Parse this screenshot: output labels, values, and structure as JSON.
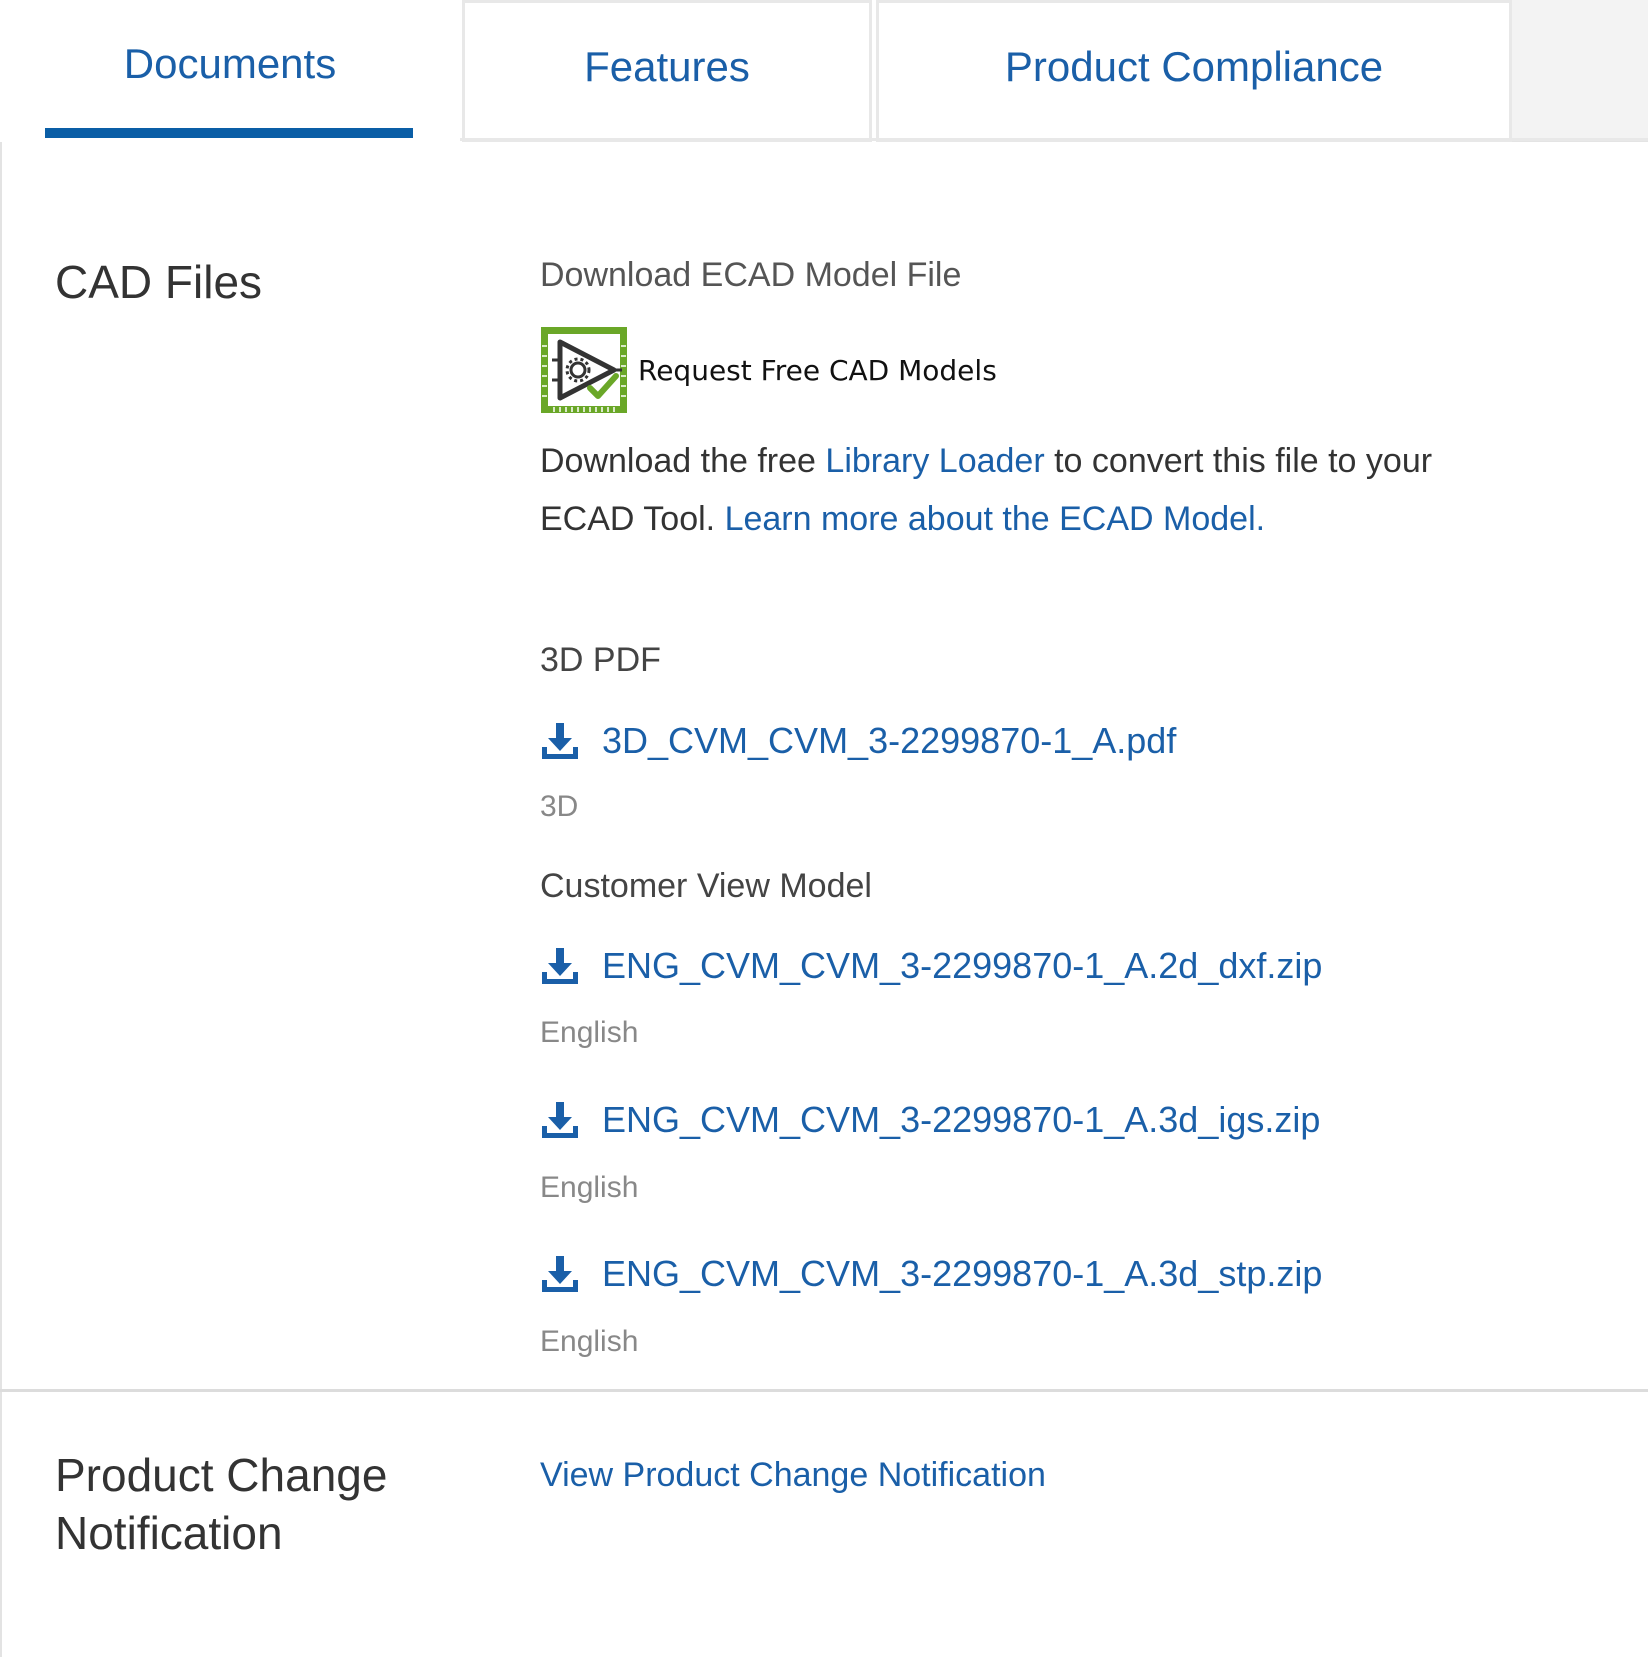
{
  "tabs": {
    "documents": "Documents",
    "features": "Features",
    "compliance": "Product Compliance"
  },
  "cad": {
    "title": "CAD Files",
    "ecad_header": "Download ECAD Model File",
    "request_link": "Request Free CAD Models",
    "para_prefix": "Download the free ",
    "library_loader": "Library Loader",
    "para_middle": " to convert this file to your ECAD Tool. ",
    "learn_more": "Learn more about the ECAD Model.",
    "pdf_header": "3D PDF",
    "cvm_header": "Customer View Model",
    "files": [
      {
        "name": "3D_CVM_CVM_3-2299870-1_A.pdf",
        "sub": "3D"
      },
      {
        "name": "ENG_CVM_CVM_3-2299870-1_A.2d_dxf.zip",
        "sub": "English"
      },
      {
        "name": "ENG_CVM_CVM_3-2299870-1_A.3d_igs.zip",
        "sub": "English"
      },
      {
        "name": "ENG_CVM_CVM_3-2299870-1_A.3d_stp.zip",
        "sub": "English"
      }
    ]
  },
  "pcn": {
    "title": "Product Change Notification",
    "link": "View Product Change Notification"
  },
  "colors": {
    "link": "#1a5fa8",
    "tab_underline": "#0a5ea6",
    "icon_green": "#6aa728"
  }
}
